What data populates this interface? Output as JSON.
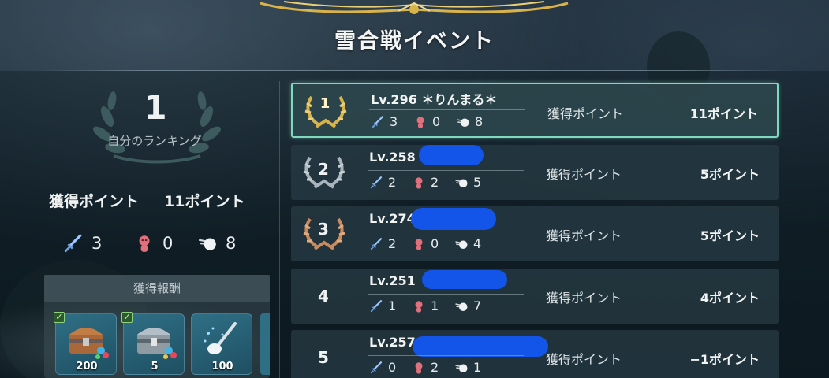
{
  "title": "雪合戦イベント",
  "summary": {
    "rank": "1",
    "rank_label": "自分のランキング",
    "points_label": "獲得ポイント",
    "points_value": "11ポイント",
    "stats": {
      "hits": "3",
      "downs": "0",
      "snowballs": "8"
    }
  },
  "rewards": {
    "title": "獲得報酬",
    "items": [
      {
        "icon": "bronze-chest-icon",
        "qty": "200",
        "claimed": true
      },
      {
        "icon": "silver-chest-icon",
        "qty": "5",
        "claimed": true
      },
      {
        "icon": "snow-shovel-icon",
        "qty": "100",
        "claimed": false
      }
    ]
  },
  "ranking": [
    {
      "rank": "1",
      "name": "Lv.296 ＊りんまる＊",
      "hits": "3",
      "downs": "0",
      "snowballs": "8",
      "points_label": "獲得ポイント",
      "points": "11ポイント"
    },
    {
      "rank": "2",
      "name": "Lv.258",
      "hits": "2",
      "downs": "2",
      "snowballs": "5",
      "points_label": "獲得ポイント",
      "points": "5ポイント"
    },
    {
      "rank": "3",
      "name": "Lv.274",
      "hits": "2",
      "downs": "0",
      "snowballs": "4",
      "points_label": "獲得ポイント",
      "points": "5ポイント"
    },
    {
      "rank": "4",
      "name": "Lv.251",
      "hits": "1",
      "downs": "1",
      "snowballs": "7",
      "points_label": "獲得ポイント",
      "points": "4ポイント"
    },
    {
      "rank": "5",
      "name": "Lv.257",
      "hits": "0",
      "downs": "2",
      "snowballs": "1",
      "points_label": "獲得ポイント",
      "points": "−1ポイント"
    }
  ],
  "colors": {
    "accent": "#7fd9bf",
    "gold": "#d8b24a",
    "silver": "#aab4bd",
    "bronze": "#c98a5c",
    "redaction": "#1255e8"
  }
}
